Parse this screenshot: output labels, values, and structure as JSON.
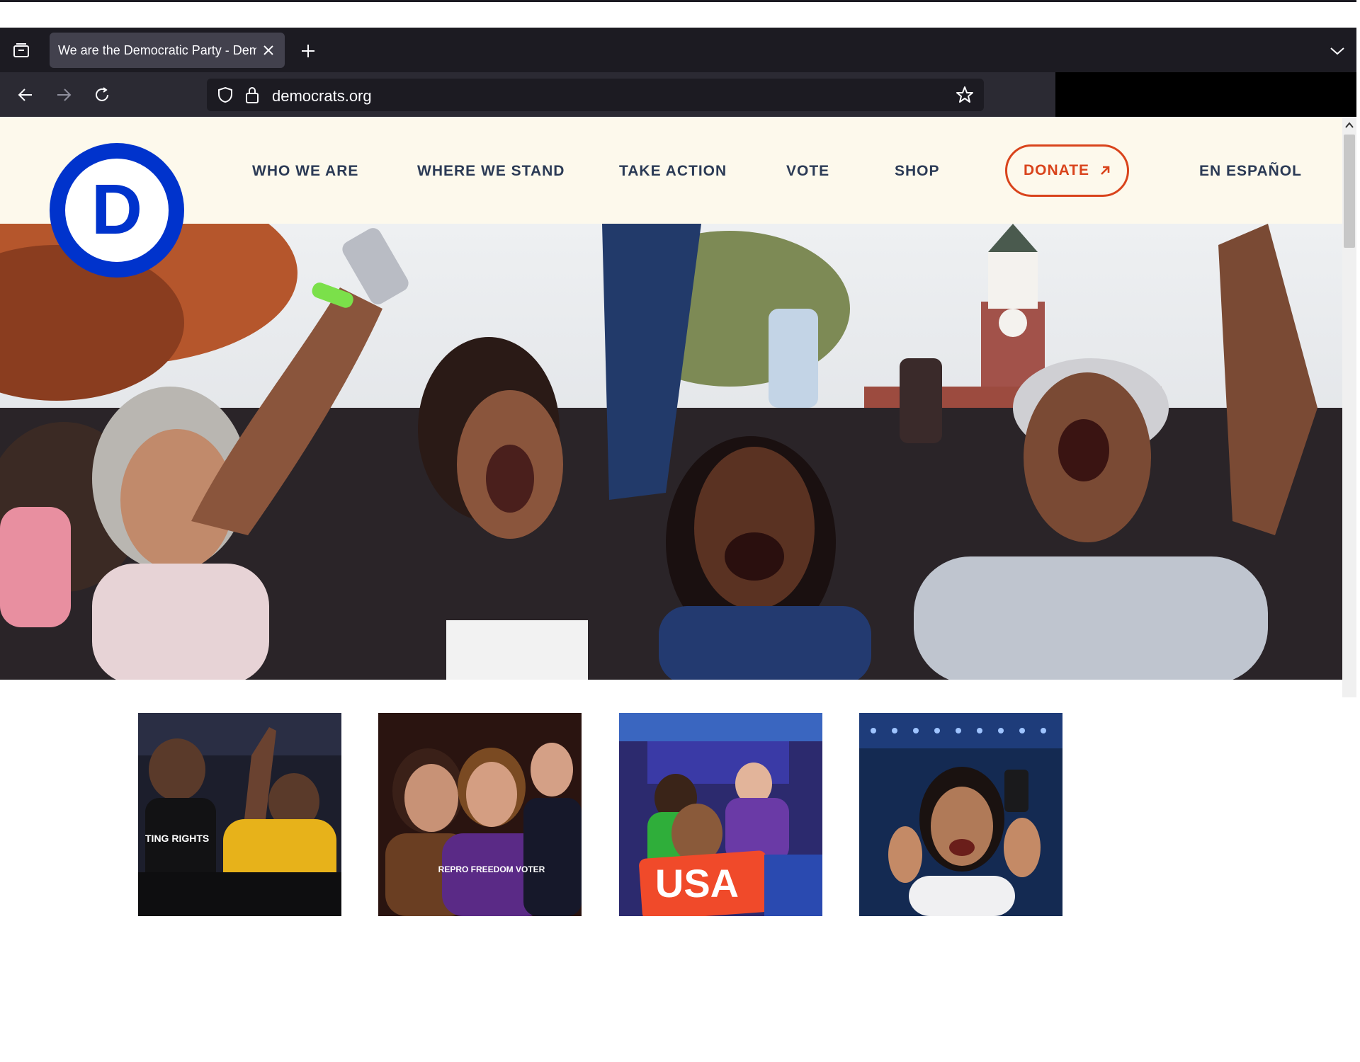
{
  "browser": {
    "tab_title": "We are the Democratic Party - Democrats",
    "url": "democrats.org"
  },
  "site": {
    "logo_letter": "D",
    "brand_color": "#0033cc",
    "accent_color": "#d9441c",
    "nav": {
      "who_we_are": "WHO WE ARE",
      "where_we_stand": "WHERE WE STAND",
      "take_action": "TAKE ACTION",
      "vote": "VOTE",
      "shop": "SHOP",
      "donate": "DONATE",
      "donate_icon": "arrow-up-right-icon",
      "en_espanol": "EN ESPAÑOL"
    },
    "thumbnails": [
      {
        "name": "rally-photo-1",
        "sign_text": "TING RIGHTS"
      },
      {
        "name": "rally-photo-2",
        "sign_text": "REPRO FREEDOM VOTER"
      },
      {
        "name": "rally-photo-3",
        "sign_text": "USA"
      },
      {
        "name": "rally-photo-4"
      }
    ]
  }
}
